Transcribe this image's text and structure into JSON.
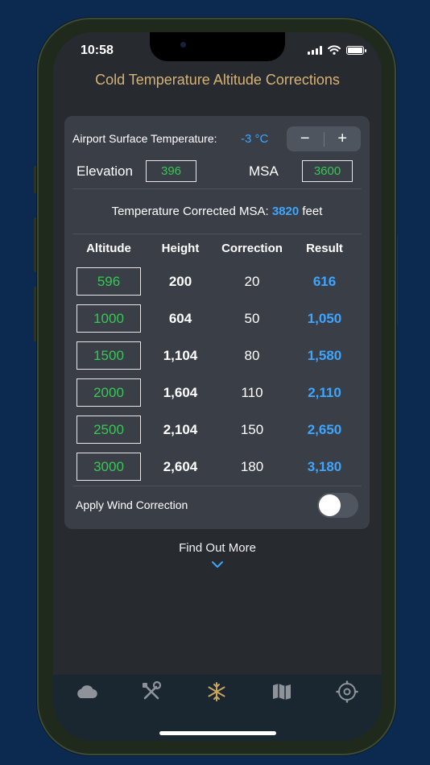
{
  "status": {
    "time": "10:58"
  },
  "title": "Cold Temperature Altitude Corrections",
  "temperature": {
    "label": "Airport Surface Temperature:",
    "value": "-3 °C",
    "minus": "−",
    "plus": "+"
  },
  "elevation": {
    "label": "Elevation",
    "value": "396"
  },
  "msa": {
    "label": "MSA",
    "value": "3600"
  },
  "corrected": {
    "label": "Temperature Corrected MSA:",
    "value": "3820",
    "unit": "feet"
  },
  "table": {
    "headers": [
      "Altitude",
      "Height",
      "Correction",
      "Result"
    ],
    "rows": [
      {
        "altitude": "596",
        "height": "200",
        "correction": "20",
        "result": "616"
      },
      {
        "altitude": "1000",
        "height": "604",
        "correction": "50",
        "result": "1,050"
      },
      {
        "altitude": "1500",
        "height": "1,104",
        "correction": "80",
        "result": "1,580"
      },
      {
        "altitude": "2000",
        "height": "1,604",
        "correction": "110",
        "result": "2,110"
      },
      {
        "altitude": "2500",
        "height": "2,104",
        "correction": "150",
        "result": "2,650"
      },
      {
        "altitude": "3000",
        "height": "2,604",
        "correction": "180",
        "result": "3,180"
      }
    ]
  },
  "wind": {
    "label": "Apply Wind Correction",
    "enabled": false
  },
  "find_more": "Find Out More",
  "tabs": [
    {
      "icon": "cloud-icon"
    },
    {
      "icon": "tools-icon"
    },
    {
      "icon": "snowflake-icon",
      "active": true
    },
    {
      "icon": "map-icon"
    },
    {
      "icon": "settings-gear-icon"
    }
  ],
  "colors": {
    "accent_blue": "#3ea5ff",
    "input_green": "#37c755",
    "title_gold": "#d6b277",
    "active_tab": "#c9a65f",
    "inactive_tab": "#8e9399"
  }
}
